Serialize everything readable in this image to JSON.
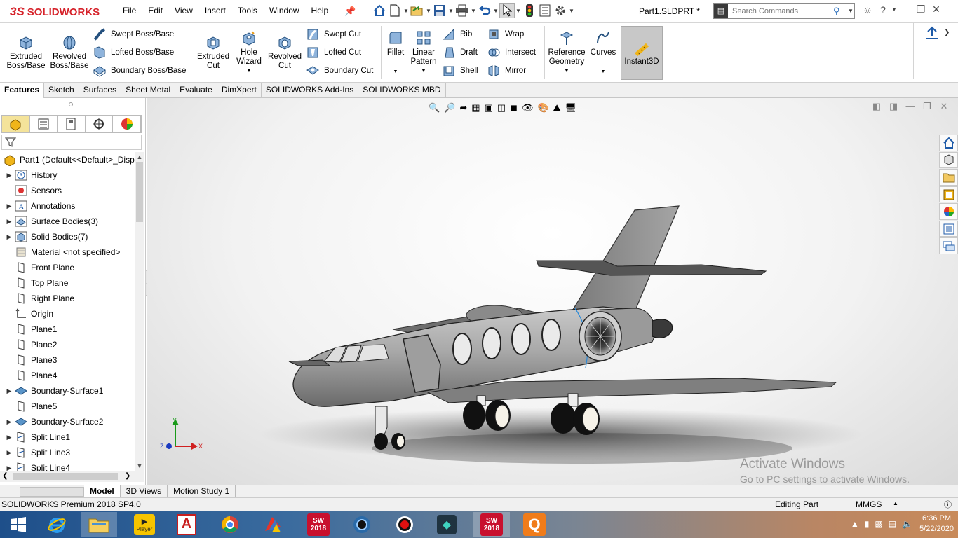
{
  "app": {
    "brand_prefix": "3S",
    "brand": "SOLIDWORKS",
    "doc_title": "Part1.SLDPRT *"
  },
  "menu": [
    "File",
    "Edit",
    "View",
    "Insert",
    "Tools",
    "Window",
    "Help"
  ],
  "search": {
    "placeholder": "Search Commands"
  },
  "ribbon": {
    "extruded_boss": "Extruded Boss/Base",
    "revolved_boss": "Revolved Boss/Base",
    "swept_boss": "Swept Boss/Base",
    "lofted_boss": "Lofted Boss/Base",
    "boundary_boss": "Boundary Boss/Base",
    "extruded_cut": "Extruded Cut",
    "hole_wizard": "Hole Wizard",
    "revolved_cut": "Revolved Cut",
    "swept_cut": "Swept Cut",
    "lofted_cut": "Lofted Cut",
    "boundary_cut": "Boundary Cut",
    "fillet": "Fillet",
    "linear_pattern": "Linear Pattern",
    "rib": "Rib",
    "draft": "Draft",
    "shell": "Shell",
    "wrap": "Wrap",
    "intersect": "Intersect",
    "mirror": "Mirror",
    "reference_geometry": "Reference Geometry",
    "curves": "Curves",
    "instant3d": "Instant3D"
  },
  "command_tabs": [
    "Features",
    "Sketch",
    "Surfaces",
    "Sheet Metal",
    "Evaluate",
    "DimXpert",
    "SOLIDWORKS Add-Ins",
    "SOLIDWORKS MBD"
  ],
  "tree": {
    "root": "Part1  (Default<<Default>_Disp",
    "items": [
      {
        "label": "History",
        "icon": "history-icon"
      },
      {
        "label": "Sensors",
        "icon": "sensors-icon"
      },
      {
        "label": "Annotations",
        "icon": "annotations-icon"
      },
      {
        "label": "Surface Bodies(3)",
        "icon": "surface-bodies-icon"
      },
      {
        "label": "Solid Bodies(7)",
        "icon": "solid-bodies-icon"
      },
      {
        "label": "Material <not specified>",
        "icon": "material-icon"
      },
      {
        "label": "Front Plane",
        "icon": "plane-icon"
      },
      {
        "label": "Top Plane",
        "icon": "plane-icon"
      },
      {
        "label": "Right Plane",
        "icon": "plane-icon"
      },
      {
        "label": "Origin",
        "icon": "origin-icon"
      },
      {
        "label": "Plane1",
        "icon": "plane-icon"
      },
      {
        "label": "Plane2",
        "icon": "plane-icon"
      },
      {
        "label": "Plane3",
        "icon": "plane-icon"
      },
      {
        "label": "Plane4",
        "icon": "plane-icon"
      },
      {
        "label": "Boundary-Surface1",
        "icon": "boundary-surface-icon"
      },
      {
        "label": "Plane5",
        "icon": "plane-icon"
      },
      {
        "label": "Boundary-Surface2",
        "icon": "boundary-surface-icon"
      },
      {
        "label": "Split Line1",
        "icon": "split-line-icon"
      },
      {
        "label": "Split Line3",
        "icon": "split-line-icon"
      },
      {
        "label": "Split Line4",
        "icon": "split-line-icon"
      }
    ]
  },
  "bottom_tabs": [
    "Model",
    "3D Views",
    "Motion Study 1"
  ],
  "status": {
    "version": "SOLIDWORKS Premium 2018 SP4.0",
    "mode": "Editing Part",
    "units": "MMGS"
  },
  "watermark": {
    "line1": "Activate Windows",
    "line2": "Go to PC settings to activate Windows."
  },
  "triad": {
    "x": "X",
    "y": "Y",
    "z": "Z"
  },
  "taskbar": {
    "player_label": "Player",
    "sw_year": "2018",
    "sw_year2": "2018",
    "sw_label": "SW",
    "q_label": "Q",
    "time": "6:36 PM",
    "date": "5/22/2020"
  }
}
